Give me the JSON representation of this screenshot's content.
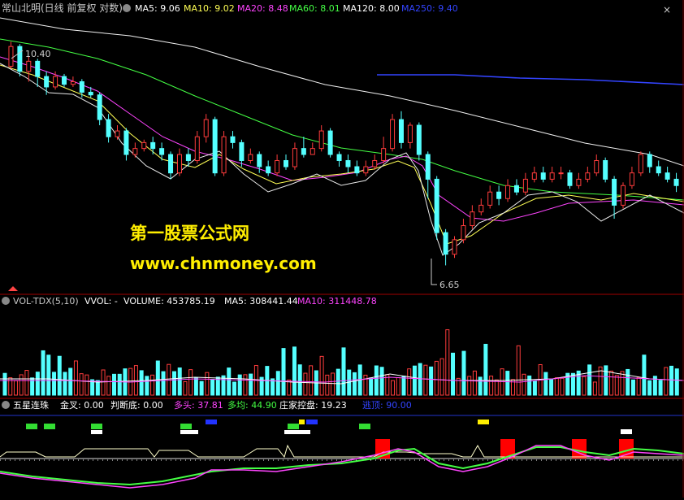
{
  "window_controls": [
    "×",
    "×"
  ],
  "price_panel": {
    "title": "常山北明(日线 前复权 对数)",
    "indicators": [
      {
        "label": "MA5: 9.06",
        "color": "#ffffff"
      },
      {
        "label": "MA10: 9.02",
        "color": "#ffff55"
      },
      {
        "label": "MA20: 8.48",
        "color": "#ff44ff"
      },
      {
        "label": "MA60: 8.01",
        "color": "#44ff44"
      },
      {
        "label": "MA120: 8.00",
        "color": "#ffffff"
      },
      {
        "label": "MA250: 9.40",
        "color": "#3344ff"
      }
    ],
    "high_label": "10.40",
    "low_label": "6.65",
    "watermark_line1": "第一股票公式网",
    "watermark_line2": "www.chnmoney.com"
  },
  "volume_panel": {
    "indicators": [
      {
        "label": "VOL-TDX(5,10)",
        "color": "#c8c8c8"
      },
      {
        "label": "VVOL: -",
        "color": "#ffffff"
      },
      {
        "label": "VOLUME: 453785.19",
        "color": "#ffffff"
      },
      {
        "label": "MA5: 308441.44",
        "color": "#ffffff"
      },
      {
        "label": "MA10: 311448.78",
        "color": "#ff44ff"
      }
    ]
  },
  "signal_panel": {
    "indicators": [
      {
        "label": "五星连珠",
        "color": "#ffffff"
      },
      {
        "label": "金叉: 0.00",
        "color": "#ffffff"
      },
      {
        "label": "判断底: 0.00",
        "color": "#ffffff"
      },
      {
        "label": "多头: 37.81",
        "color": "#ff44ff"
      },
      {
        "label": "多均: 44.90",
        "color": "#44ff44"
      },
      {
        "label": "庄家控盘: 19.23",
        "color": "#ffffff"
      },
      {
        "label": "逃顶: 90.00",
        "color": "#3344ff"
      }
    ]
  },
  "chart_data": {
    "type": "candlestick",
    "ylim": [
      6.4,
      10.8
    ],
    "candles": [
      [
        9.9,
        10.3,
        10.4,
        9.85
      ],
      [
        10.3,
        9.8,
        10.35,
        9.7
      ],
      [
        9.8,
        10.0,
        10.1,
        9.6
      ],
      [
        10.0,
        9.7,
        10.05,
        9.5
      ],
      [
        9.7,
        9.5,
        9.8,
        9.35
      ],
      [
        9.5,
        9.7,
        9.8,
        9.45
      ],
      [
        9.7,
        9.55,
        9.75,
        9.5
      ],
      [
        9.55,
        9.6,
        9.7,
        9.5
      ],
      [
        9.6,
        9.4,
        9.65,
        9.3
      ],
      [
        9.4,
        9.35,
        9.5,
        9.3
      ],
      [
        9.35,
        8.9,
        9.4,
        8.8
      ],
      [
        8.9,
        8.6,
        9.0,
        8.5
      ],
      [
        8.6,
        8.7,
        8.8,
        8.55
      ],
      [
        8.7,
        8.3,
        8.75,
        8.2
      ],
      [
        8.3,
        8.4,
        8.5,
        8.25
      ],
      [
        8.4,
        8.5,
        8.55,
        8.35
      ],
      [
        8.5,
        8.4,
        8.6,
        8.3
      ],
      [
        8.4,
        8.3,
        8.5,
        8.2
      ],
      [
        8.3,
        8.0,
        8.35,
        7.9
      ],
      [
        8.0,
        8.3,
        8.4,
        7.95
      ],
      [
        8.3,
        8.2,
        8.4,
        8.1
      ],
      [
        8.2,
        8.6,
        8.7,
        8.15
      ],
      [
        8.6,
        8.9,
        9.0,
        8.5
      ],
      [
        8.9,
        8.0,
        8.95,
        7.95
      ],
      [
        8.0,
        8.6,
        8.7,
        7.95
      ],
      [
        8.6,
        8.5,
        8.7,
        8.4
      ],
      [
        8.5,
        8.2,
        8.55,
        8.1
      ],
      [
        8.2,
        8.3,
        8.4,
        8.15
      ],
      [
        8.3,
        8.1,
        8.35,
        8.0
      ],
      [
        8.1,
        8.0,
        8.2,
        7.95
      ],
      [
        8.0,
        8.2,
        8.3,
        7.95
      ],
      [
        8.2,
        8.1,
        8.3,
        8.05
      ],
      [
        8.1,
        8.4,
        8.5,
        8.05
      ],
      [
        8.4,
        8.3,
        8.6,
        8.25
      ],
      [
        8.3,
        8.4,
        8.5,
        8.3
      ],
      [
        8.4,
        8.7,
        8.8,
        8.35
      ],
      [
        8.7,
        8.3,
        8.75,
        8.25
      ],
      [
        8.3,
        8.2,
        8.35,
        8.1
      ],
      [
        8.2,
        8.1,
        8.3,
        8.0
      ],
      [
        8.1,
        8.0,
        8.2,
        7.95
      ],
      [
        8.0,
        8.1,
        8.2,
        7.95
      ],
      [
        8.1,
        8.2,
        8.3,
        8.05
      ],
      [
        8.2,
        8.4,
        8.6,
        8.15
      ],
      [
        8.4,
        8.9,
        9.0,
        8.35
      ],
      [
        8.9,
        8.5,
        9.05,
        8.4
      ],
      [
        8.5,
        8.8,
        8.85,
        8.4
      ],
      [
        8.8,
        8.3,
        8.85,
        8.2
      ],
      [
        8.3,
        7.9,
        8.35,
        7.6
      ],
      [
        7.9,
        7.1,
        7.95,
        7.0
      ],
      [
        7.1,
        6.8,
        7.15,
        6.65
      ],
      [
        6.8,
        7.0,
        7.05,
        6.75
      ],
      [
        7.0,
        7.2,
        7.3,
        6.95
      ],
      [
        7.2,
        7.4,
        7.5,
        7.15
      ],
      [
        7.4,
        7.5,
        7.6,
        7.35
      ],
      [
        7.5,
        7.7,
        7.8,
        7.45
      ],
      [
        7.7,
        7.6,
        7.8,
        7.5
      ],
      [
        7.6,
        7.8,
        7.9,
        7.55
      ],
      [
        7.8,
        7.7,
        7.9,
        7.65
      ],
      [
        7.7,
        7.9,
        8.0,
        7.65
      ],
      [
        7.9,
        8.0,
        8.1,
        7.85
      ],
      [
        8.0,
        7.9,
        8.1,
        7.85
      ],
      [
        7.9,
        8.0,
        8.1,
        7.85
      ],
      [
        8.0,
        8.0,
        8.1,
        7.9
      ],
      [
        8.0,
        7.8,
        8.05,
        7.75
      ],
      [
        7.8,
        7.9,
        8.0,
        7.75
      ],
      [
        7.9,
        8.0,
        8.1,
        7.85
      ],
      [
        8.0,
        8.2,
        8.3,
        7.95
      ],
      [
        8.2,
        7.9,
        8.25,
        7.85
      ],
      [
        7.9,
        7.5,
        7.95,
        7.3
      ],
      [
        7.5,
        7.8,
        7.85,
        7.45
      ],
      [
        7.8,
        8.0,
        8.1,
        7.75
      ],
      [
        8.0,
        8.3,
        8.35,
        7.95
      ],
      [
        8.3,
        8.1,
        8.35,
        8.0
      ],
      [
        8.1,
        8.0,
        8.2,
        7.95
      ],
      [
        8.0,
        7.9,
        8.1,
        7.85
      ],
      [
        7.9,
        7.8,
        8.0,
        7.7
      ]
    ]
  }
}
